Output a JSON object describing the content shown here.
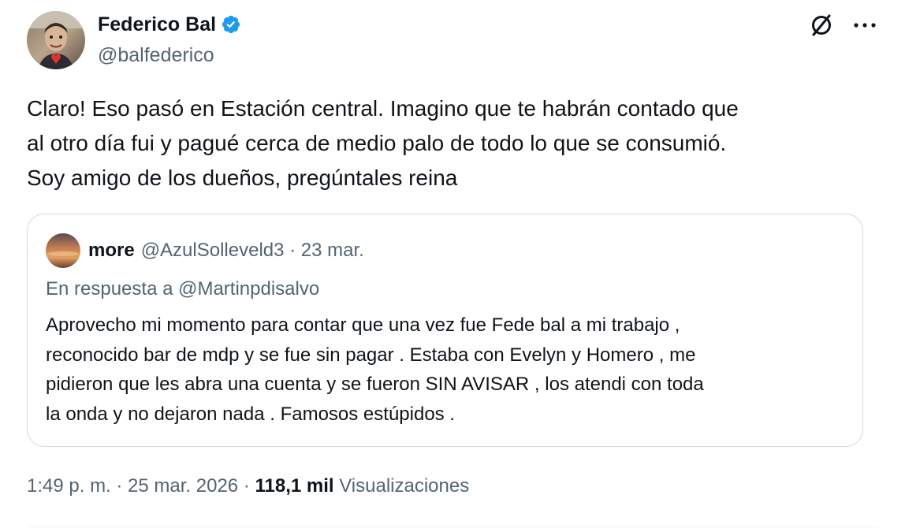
{
  "author": {
    "display_name": "Federico Bal",
    "handle": "@balfederico",
    "verified": true
  },
  "icons": {
    "verified": "verified-badge-icon",
    "grok": "grok-icon",
    "more": "more-horizontal-icon"
  },
  "colors": {
    "text_primary": "#0f1419",
    "text_secondary": "#536471",
    "verified_blue": "#1d9bf0",
    "border": "#cfd9de"
  },
  "tweet": {
    "text": "Claro! Eso pasó en Estación central. Imagino que te habrán contado que\nal otro día fui y pagué cerca de medio palo de todo lo que se consumió.\nSoy amigo de los dueños, pregúntales reina"
  },
  "quoted_tweet": {
    "display_name": "more",
    "meta": "@AzulSolleveld3 · 23 mar.",
    "reply_to": "En respuesta a @Martinpdisalvo",
    "text": "Aprovecho mi momento para contar que una vez fue Fede bal a mi trabajo ,\nreconocido bar de mdp y se fue sin pagar . Estaba con Evelyn y Homero , me\npidieron que les abra una cuenta y se fueron SIN AVISAR , los atendi con toda\nla onda y no dejaron nada . Famosos estúpidos ."
  },
  "footer": {
    "timestamp": "1:49 p. m. · 25 mar. 2026 · ",
    "views_count": "118,1 mil",
    "views_label": " Visualizaciones"
  }
}
